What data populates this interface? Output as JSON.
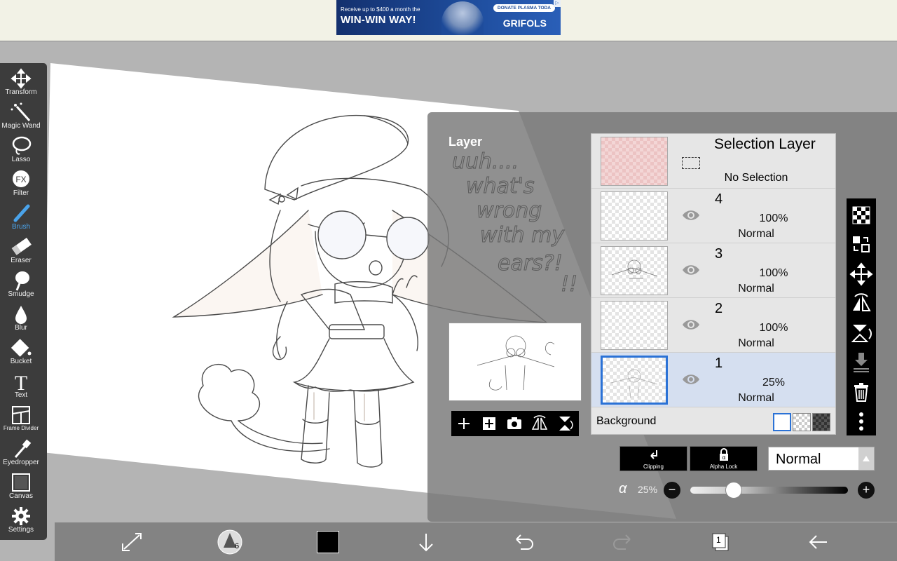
{
  "ad": {
    "small_text": "Receive up to $400 a month the",
    "headline": "WIN-WIN WAY!",
    "cta": "DONATE PLASMA TODA",
    "brand": "GRIFOLS"
  },
  "toolbar": {
    "tools": [
      {
        "label": "Transform",
        "icon": "move-arrows-icon"
      },
      {
        "label": "Magic Wand",
        "icon": "magic-wand-icon"
      },
      {
        "label": "Lasso",
        "icon": "lasso-icon"
      },
      {
        "label": "Filter",
        "icon": "fx-filter-icon"
      },
      {
        "label": "Brush",
        "icon": "brush-icon",
        "active": true
      },
      {
        "label": "Eraser",
        "icon": "eraser-icon"
      },
      {
        "label": "Smudge",
        "icon": "smudge-icon"
      },
      {
        "label": "Blur",
        "icon": "droplet-icon"
      },
      {
        "label": "Bucket",
        "icon": "bucket-icon"
      },
      {
        "label": "Text",
        "icon": "text-t-icon"
      },
      {
        "label": "Frame Divider",
        "icon": "frame-divider-icon"
      },
      {
        "label": "Eyedropper",
        "icon": "eyedropper-icon"
      },
      {
        "label": "Canvas",
        "icon": "canvas-icon"
      },
      {
        "label": "Settings",
        "icon": "gear-icon"
      }
    ],
    "accent_color": "#4aa3ea"
  },
  "canvas_text": {
    "handwriting": [
      "uuh....",
      "what's",
      "wrong",
      "with my",
      "ears?!",
      "!!"
    ]
  },
  "layer_panel": {
    "title": "Layer",
    "selection_layer": {
      "title": "Selection Layer",
      "status": "No Selection"
    },
    "layers": [
      {
        "name": "4",
        "opacity": "100%",
        "mode": "Normal",
        "visible": true
      },
      {
        "name": "3",
        "opacity": "100%",
        "mode": "Normal",
        "visible": true
      },
      {
        "name": "2",
        "opacity": "100%",
        "mode": "Normal",
        "visible": true
      },
      {
        "name": "1",
        "opacity": "25%",
        "mode": "Normal",
        "visible": true,
        "active": true
      }
    ],
    "background_label": "Background",
    "clipping_label": "Clipping",
    "alpha_lock_label": "Alpha Lock",
    "blend_mode": "Normal",
    "alpha_symbol": "α",
    "alpha_value": "25%",
    "alpha_fraction": 0.25,
    "active_color": "#2b72d6"
  },
  "bottom_bar": {
    "brush_size": "6",
    "current_color": "#000000",
    "layer_count": "1"
  }
}
